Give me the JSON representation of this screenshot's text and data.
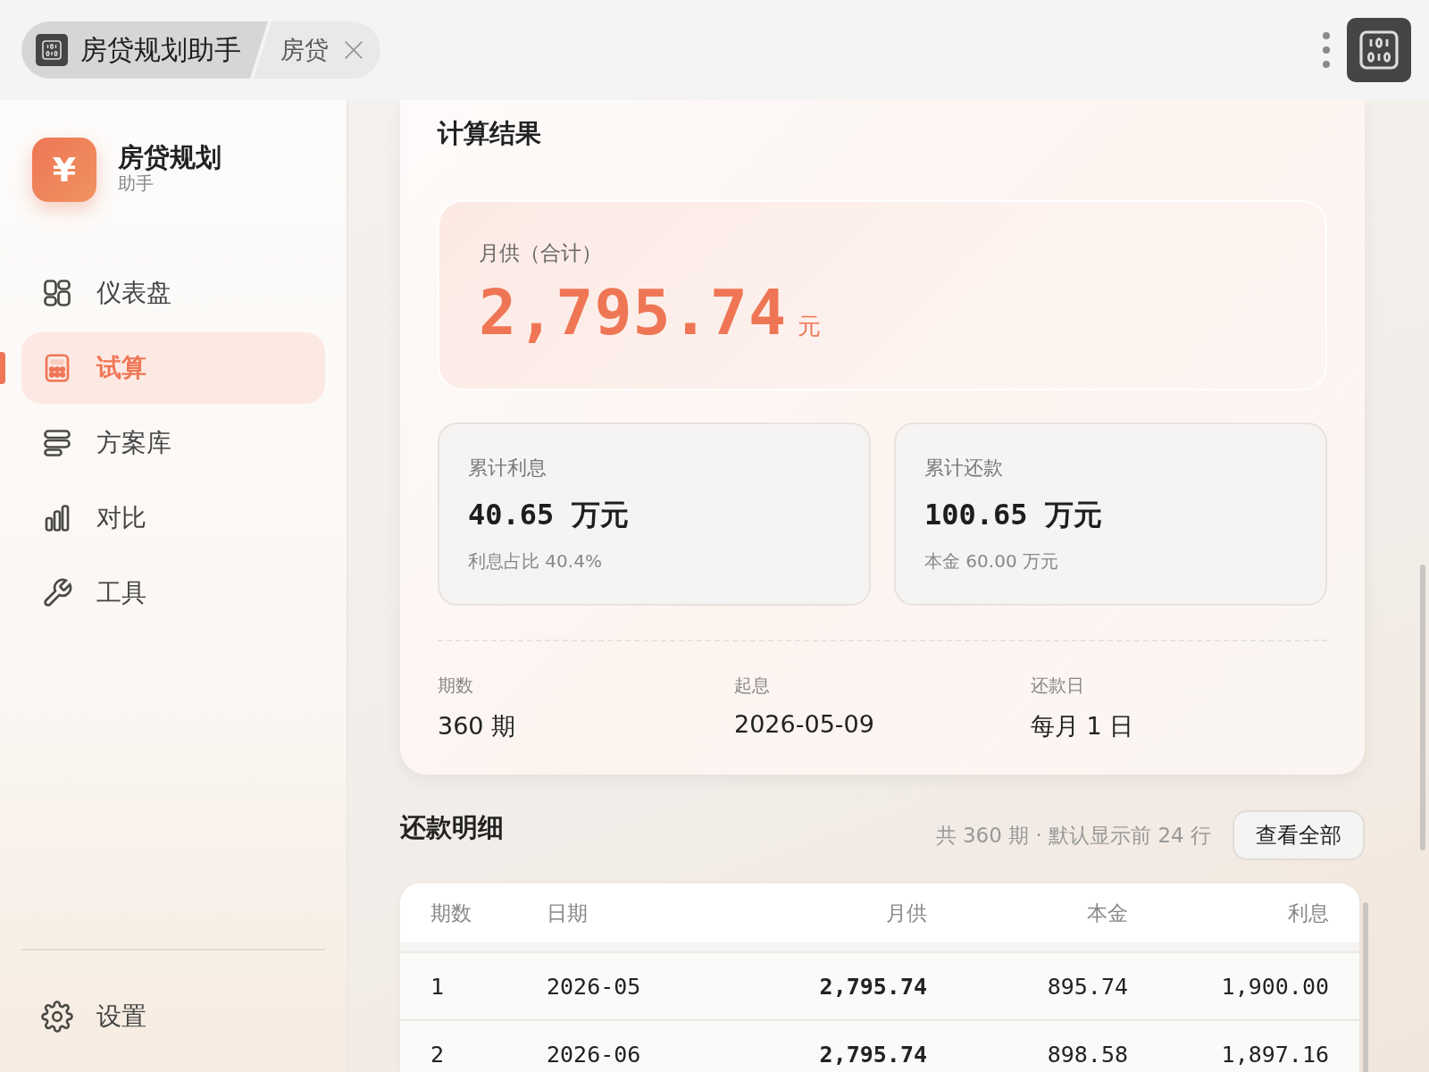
{
  "tab_bar": {
    "tabs": [
      {
        "label": "房贷规划助手",
        "selected": true,
        "kind": "app"
      },
      {
        "label": "房贷",
        "selected": false,
        "kind": "page"
      }
    ]
  },
  "sidebar": {
    "brand": {
      "mark": "¥",
      "title": "房贷规划",
      "subtitle": "助手"
    },
    "items": [
      {
        "label": "仪表盘",
        "selected": false
      },
      {
        "label": "试算",
        "selected": true
      },
      {
        "label": "方案库",
        "selected": false
      },
      {
        "label": "对比",
        "selected": false
      },
      {
        "label": "工具",
        "selected": false
      }
    ],
    "footer": {
      "label": "设置"
    }
  },
  "result": {
    "title": "计算结果",
    "monthly": {
      "label": "月供（合计）",
      "value": "2,795.74",
      "unit": "元"
    },
    "stats": [
      {
        "label": "累计利息",
        "value": "40.65",
        "unit": "万元",
        "note": "利息占比 40.4%"
      },
      {
        "label": "累计还款",
        "value": "100.65",
        "unit": "万元",
        "note": "本金 60.00 万元"
      }
    ],
    "info": [
      {
        "label": "期数",
        "value": "360 期"
      },
      {
        "label": "起息",
        "value": "2026-05-09"
      },
      {
        "label": "还款日",
        "value": "每月 1 日"
      }
    ]
  },
  "schedule": {
    "title": "还款明细",
    "summary": "共 360 期 · 默认显示前 24 行",
    "button": "查看全部",
    "columns": [
      "期数",
      "日期",
      "月供",
      "本金",
      "利息"
    ],
    "rows": [
      [
        "1",
        "2026-05",
        "2,795.74",
        "895.74",
        "1,900.00"
      ],
      [
        "2",
        "2026-06",
        "2,795.74",
        "898.58",
        "1,897.16"
      ]
    ]
  }
}
